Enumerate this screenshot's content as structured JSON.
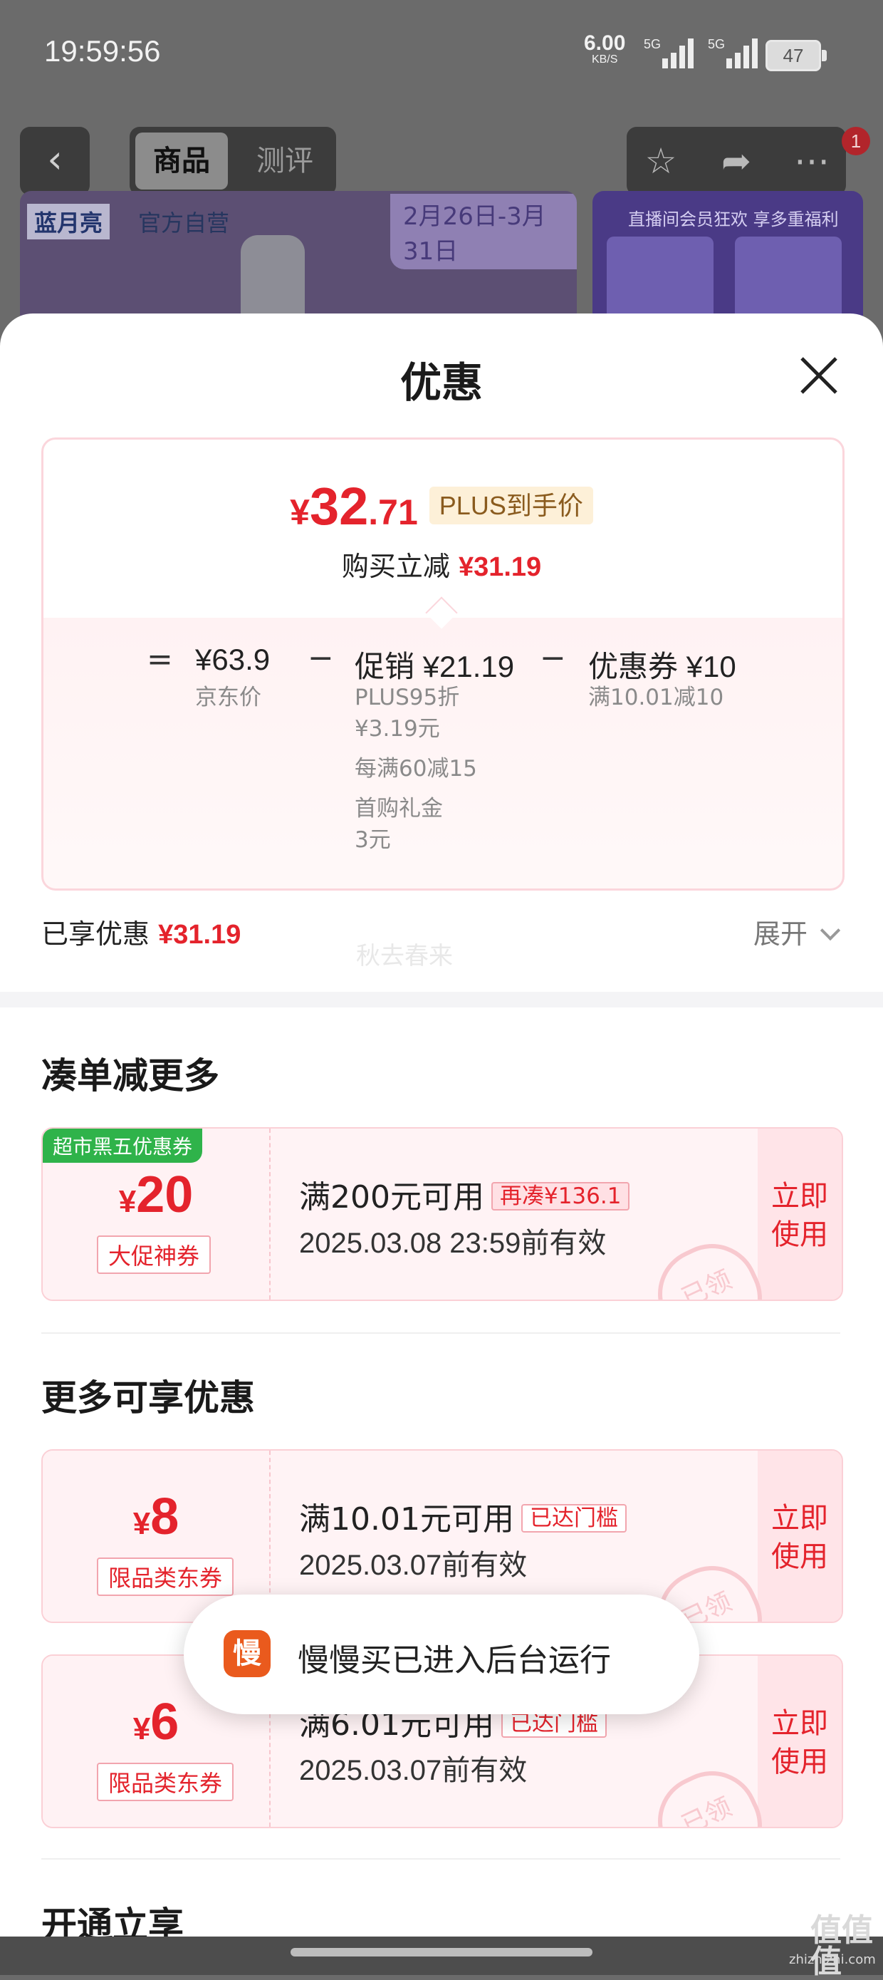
{
  "status_bar": {
    "time": "19:59:56",
    "speed_value": "6.00",
    "speed_unit": "KB/S",
    "net1": "5G",
    "net2": "5G",
    "battery": "47"
  },
  "nav": {
    "tab_goods": "商品",
    "tab_review": "测评",
    "cart_badge": "1"
  },
  "banner": {
    "brand": "蓝月亮",
    "store": "官方自营",
    "date_range": "2月26日-3月31日",
    "promo": "直播间会员狂欢 享多重福利"
  },
  "sheet": {
    "title": "优惠",
    "price": {
      "yen": "¥",
      "integer": "32",
      "decimal": ".71",
      "tag": "PLUS到手价"
    },
    "instant": {
      "label": "购买立减",
      "amount": "¥31.19"
    },
    "breakdown": {
      "eq": "=",
      "minus1": "−",
      "minus2": "−",
      "jd": {
        "value": "¥63.9",
        "label": "京东价"
      },
      "promo": {
        "value": "促销 ¥21.19",
        "lines": [
          "PLUS95折",
          "¥3.19元",
          "每满60减15",
          "首购礼金",
          "3元"
        ]
      },
      "coupon": {
        "value": "优惠券 ¥10",
        "label": "满10.01减10"
      }
    },
    "enjoyed": {
      "label": "已享优惠",
      "amount": "¥31.19"
    },
    "watermark": "秋去春来",
    "expand": "展开"
  },
  "section_more": {
    "title": "凑单减更多",
    "coupon": {
      "corner": "超市黑五优惠券",
      "yen": "¥",
      "amount": "20",
      "type": "大促神券",
      "title": "满200元可用",
      "tag": "再凑¥136.1",
      "date": "2025.03.08 23:59前有效",
      "use1": "立即",
      "use2": "使用",
      "stamp": "已领"
    }
  },
  "section_avail": {
    "title": "更多可享优惠",
    "coupons": [
      {
        "yen": "¥",
        "amount": "8",
        "type": "限品类东券",
        "title": "满10.01元可用",
        "tag": "已达门槛",
        "date": "2025.03.07前有效",
        "use1": "立即",
        "use2": "使用",
        "stamp": "已领"
      },
      {
        "yen": "¥",
        "amount": "6",
        "type": "限品类东券",
        "title": "满6.01元可用",
        "tag": "已达门槛",
        "date": "2025.03.07前有效",
        "use1": "立即",
        "use2": "使用",
        "stamp": "已领"
      }
    ]
  },
  "section_plus": {
    "title": "开通立享"
  },
  "toast": {
    "icon": "慢",
    "text": "慢慢买已进入后台运行"
  },
  "site_watermark": {
    "logo": "值值值",
    "url": "zhizhizhi.com"
  }
}
